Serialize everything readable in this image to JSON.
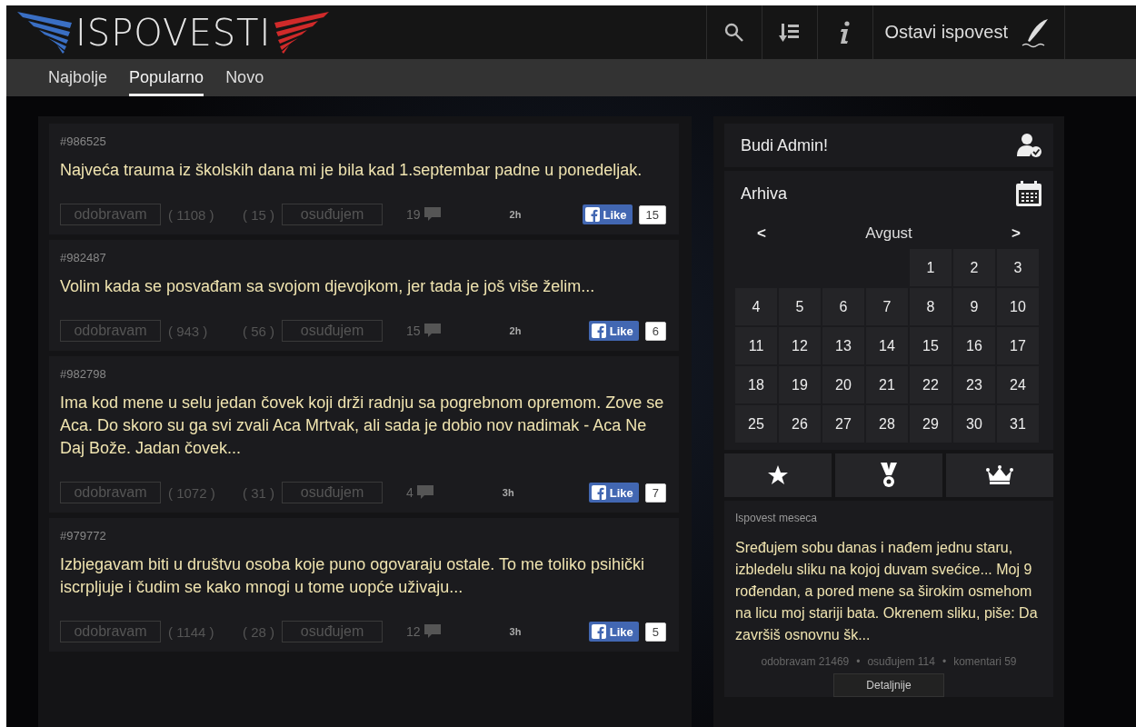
{
  "header": {
    "logo": "ISPOVESTI",
    "actions": [
      {
        "kind": "search"
      },
      {
        "kind": "sort"
      },
      {
        "kind": "info"
      }
    ],
    "submit": "Ostavi ispovest"
  },
  "tabs": [
    {
      "label": "Najbolje",
      "selected": false
    },
    {
      "label": "Popularno",
      "selected": true
    },
    {
      "label": "Novo",
      "selected": false
    }
  ],
  "posts": [
    {
      "id": "#986525",
      "text": "Najveća trauma iz školskih dana mi je bila kad 1.septembar padne u ponedeljak.",
      "approve": "odobravam",
      "approve_count": "( 1108 )",
      "condemn_count": "( 15 )",
      "condemn": "osuđujem",
      "comments": "19",
      "age": "2h",
      "like": "Like",
      "likes": "15"
    },
    {
      "id": "#982487",
      "text": "Volim kada se posvađam sa svojom djevojkom, jer tada je još više želim...",
      "approve": "odobravam",
      "approve_count": "( 943 )",
      "condemn_count": "( 56 )",
      "condemn": "osuđujem",
      "comments": "15",
      "age": "2h",
      "like": "Like",
      "likes": "6"
    },
    {
      "id": "#982798",
      "text": "Ima kod mene u selu jedan čovek koji drži radnju sa pogrebnom opremom. Zove se Aca. Do skoro su ga svi zvali Aca Mrtvak, ali sada je dobio nov nadimak - Aca Ne Daj Bože. Jadan čovek...",
      "approve": "odobravam",
      "approve_count": "( 1072 )",
      "condemn_count": "( 31 )",
      "condemn": "osuđujem",
      "comments": "4",
      "age": "3h",
      "like": "Like",
      "likes": "7"
    },
    {
      "id": "#979772",
      "text": "Izbjegavam biti u društvu osoba koje puno ogovaraju ostale. To me toliko psihički iscrpljuje i čudim se kako mnogi u tome uopće uživaju...",
      "approve": "odobravam",
      "approve_count": "( 1144 )",
      "condemn_count": "( 28 )",
      "condemn": "osuđujem",
      "comments": "12",
      "age": "3h",
      "like": "Like",
      "likes": "5"
    }
  ],
  "sidebar": {
    "admin": "Budi Admin!",
    "archive": "Arhiva",
    "calendar": {
      "prev": "<",
      "month": "Avgust",
      "next": ">",
      "weeks": [
        [
          "1",
          "2",
          "3"
        ],
        [
          "4",
          "5",
          "6",
          "7",
          "8",
          "9",
          "10"
        ],
        [
          "11",
          "12",
          "13",
          "14",
          "15",
          "16",
          "17"
        ],
        [
          "18",
          "19",
          "20",
          "21",
          "22",
          "23",
          "24"
        ],
        [
          "25",
          "26",
          "27",
          "28",
          "29",
          "30",
          "31"
        ]
      ]
    },
    "award_tabs": [
      {
        "kind": "star"
      },
      {
        "kind": "medal"
      },
      {
        "kind": "crown"
      }
    ],
    "month_title": "Ispovest meseca",
    "month_text": "Sređujem sobu danas i nađem jednu staru, izbledelu sliku na kojoj duvam svećice... Moj 9 rođendan, a pored mene sa širokim osmehom na licu moj stariji bata. Okrenem sliku, piše: Da završiš osnovnu šk...",
    "stats": [
      "odobravam 21469",
      "osuđujem 114",
      "komentari 59"
    ],
    "stats_sep": "•",
    "details": "Detaljnije"
  }
}
